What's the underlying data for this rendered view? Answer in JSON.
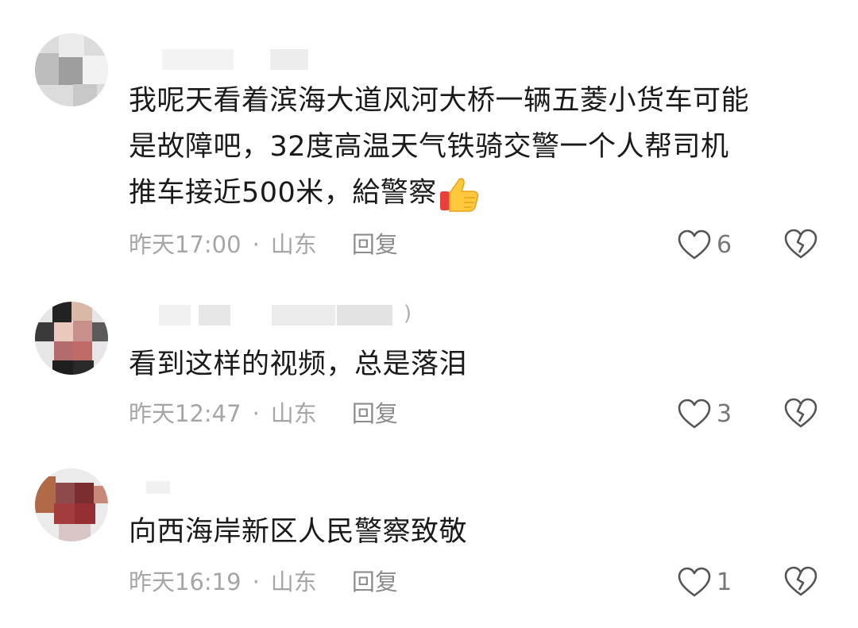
{
  "comments": [
    {
      "text_lines": [
        "我呢天看着滨海大道风河大桥一辆五菱小货车可能",
        "是故障吧，32度高温天气铁骑交警一个人帮司机",
        "推车接近500米，給警察"
      ],
      "emoji": "thumbs-up",
      "time": "昨天17:00",
      "location": "山东",
      "reply_label": "回复",
      "likes": "6"
    },
    {
      "username_suffix": ")",
      "text_lines": [
        "看到这样的视频，总是落泪"
      ],
      "time": "昨天12:47",
      "location": "山东",
      "reply_label": "回复",
      "likes": "3"
    },
    {
      "text_lines": [
        "向西海岸新区人民警察致敬"
      ],
      "time": "昨天16:19",
      "location": "山东",
      "reply_label": "回复",
      "likes": "1"
    }
  ],
  "separator": "·",
  "colors": {
    "text": "#1a1a1a",
    "meta": "#a6a6a6",
    "icon": "#555555"
  }
}
